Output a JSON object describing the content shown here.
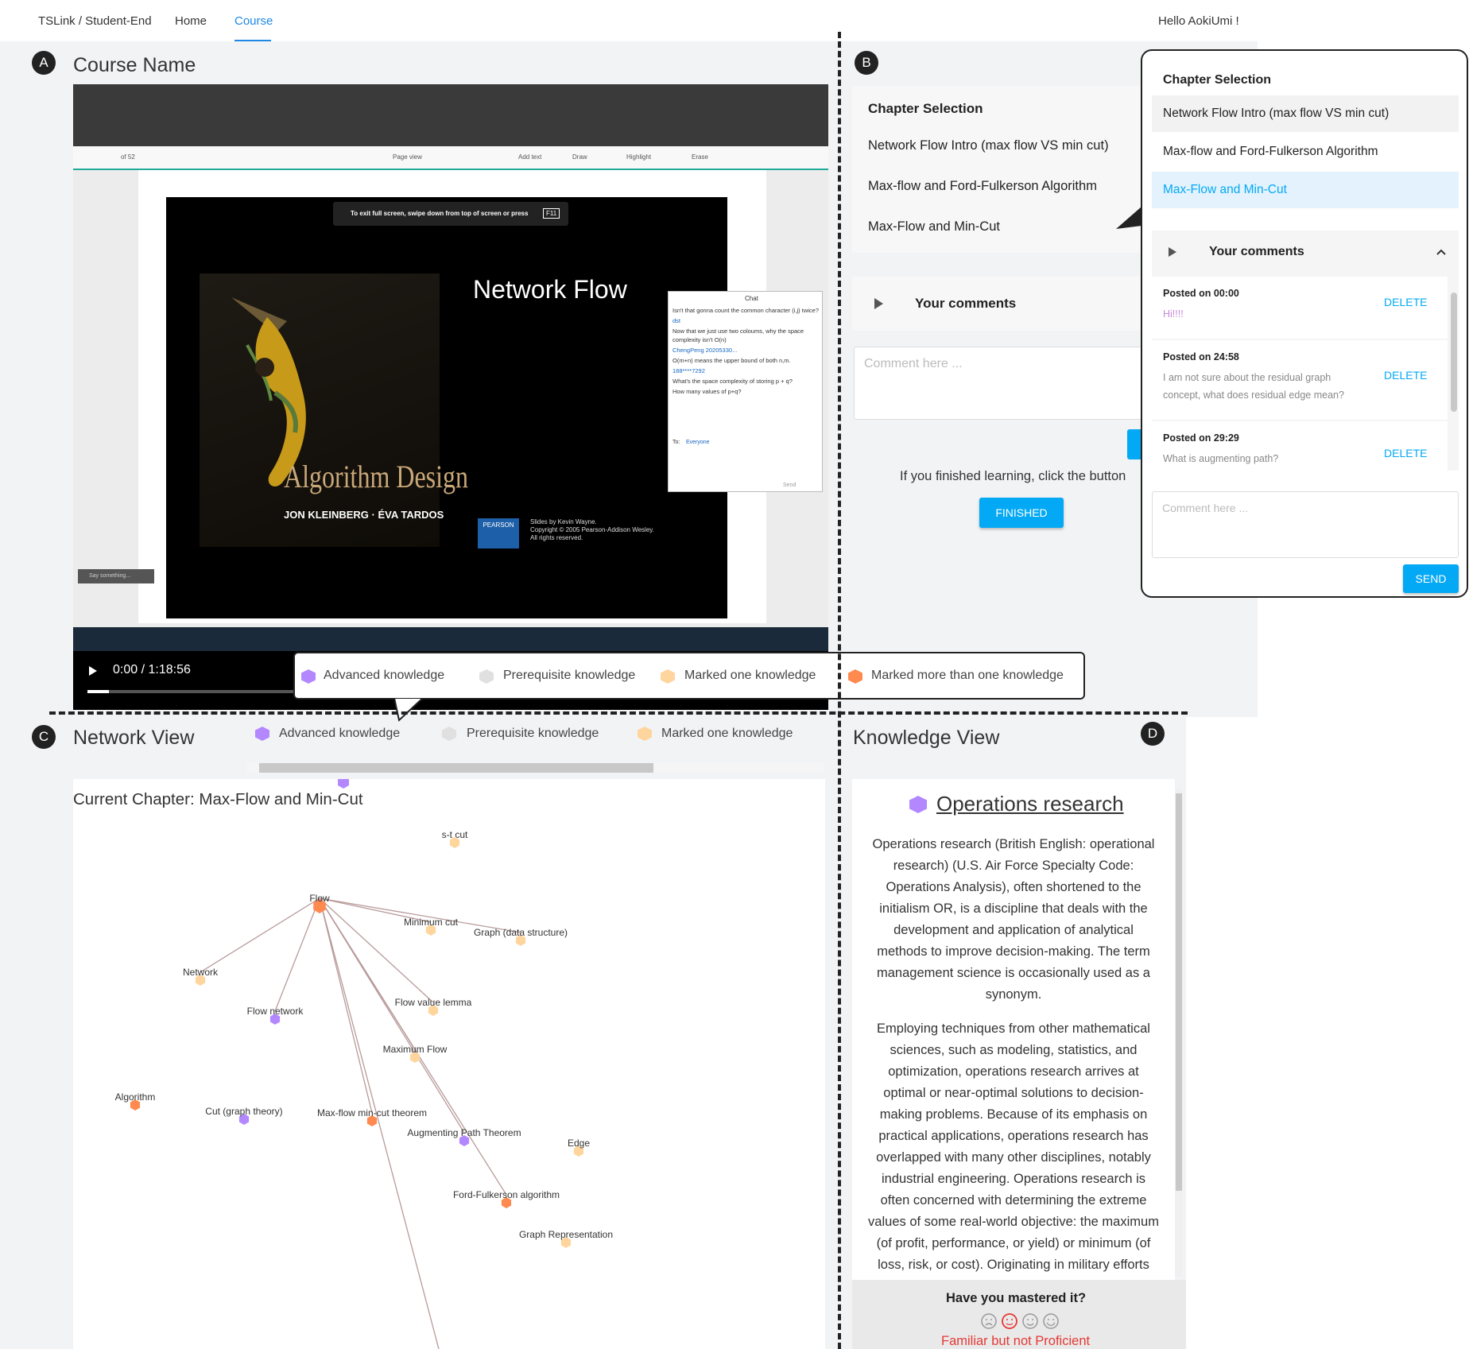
{
  "nav": {
    "brand": "TSLink / Student-End",
    "home": "Home",
    "course": "Course",
    "greeting": "Hello AokiUmi !"
  },
  "badges": {
    "a": "A",
    "b": "B",
    "c": "C",
    "d": "D"
  },
  "video": {
    "title": "Course Name",
    "time": "0:00 / 1:18:56",
    "progress": 0.03,
    "slide_exit_hint": "To exit full screen, swipe down from top of screen or press",
    "slide_key": "F11",
    "slide_title": "Network Flow",
    "book_title": "Algorithm Design",
    "book_authors": "JON KLEINBERG · ÉVA TARDOS",
    "publisher": "PEARSON",
    "credit1": "Slides by Kevin Wayne.",
    "credit2": "Copyright © 2005 Pearson-Addison Wesley.",
    "credit3": "All rights reserved.",
    "toolbar_page": "of 52",
    "toolbar_add_text": "Add text",
    "toolbar_draw": "Draw",
    "toolbar_highlight": "Highlight",
    "toolbar_erase": "Erase",
    "toolbar_pageview": "Page view",
    "chat_title": "Chat",
    "chat_to_label": "To:",
    "chat_to": "Everyone",
    "chat_send": "Send",
    "chat_lines": [
      "Isn't that gonna count the common character (i,j) twice?",
      "dst",
      "Now that we just use two coloums, why the space complexity isn't O(n)",
      "ChengPeng 20205330...",
      "O(m+n) means the upper bound of both n,m.",
      "188****7292",
      "What's the space complexity of storing p + q?",
      "How many values of p+q?"
    ],
    "say_something": "Say something..."
  },
  "legend": {
    "advanced": "Advanced knowledge",
    "prerequisite": "Prerequisite knowledge",
    "marked_one": "Marked one knowledge",
    "marked_more": "Marked more than one knowledge",
    "colors": {
      "advanced": "#b388ff",
      "prerequisite": "#e0e0e0",
      "marked_one": "#ffd59e",
      "marked_more": "#ff8a50"
    }
  },
  "chapters": {
    "heading": "Chapter Selection",
    "items": [
      "Network Flow Intro (max flow VS min cut)",
      "Max-flow and Ford-Fulkerson Algorithm",
      "Max-Flow and Min-Cut"
    ],
    "selected": 2
  },
  "comments": {
    "heading": "Your comments",
    "placeholder": "Comment here ...",
    "finish_prompt": "If you finished learning, click the button",
    "finished": "FINISHED",
    "send": "SEND",
    "delete": "DELETE",
    "items": [
      {
        "posted": "Posted on 00:00",
        "text": "Hi!!!!"
      },
      {
        "posted": "Posted on 24:58",
        "text1": "I am not sure about the residual graph",
        "text2": "concept, what does residual edge mean?"
      },
      {
        "posted": "Posted on 29:29",
        "text": "What is augmenting path?"
      }
    ]
  },
  "network": {
    "title": "Network View",
    "current_chapter": "Current Chapter: Max-Flow and Min-Cut",
    "nodes": [
      {
        "label": "Flow",
        "type": "marked_more"
      },
      {
        "label": "s-t cut",
        "type": "marked_one"
      },
      {
        "label": "Minimum cut",
        "type": "marked_one"
      },
      {
        "label": "Graph (data structure)",
        "type": "marked_one"
      },
      {
        "label": "Network",
        "type": "marked_one"
      },
      {
        "label": "Flow network",
        "type": "advanced"
      },
      {
        "label": "Flow value lemma",
        "type": "marked_one"
      },
      {
        "label": "Maximum Flow",
        "type": "marked_one"
      },
      {
        "label": "Algorithm",
        "type": "marked_more"
      },
      {
        "label": "Cut (graph theory)",
        "type": "advanced"
      },
      {
        "label": "Max-flow min-cut theorem",
        "type": "marked_more"
      },
      {
        "label": "Augmenting Path Theorem",
        "type": "advanced"
      },
      {
        "label": "Edge",
        "type": "marked_one"
      },
      {
        "label": "Ford-Fulkerson algorithm",
        "type": "marked_more"
      },
      {
        "label": "Graph Representation",
        "type": "marked_one"
      }
    ]
  },
  "knowledge": {
    "title": "Knowledge View",
    "topic": "Operations research",
    "p1": [
      "Operations research (British English: operational",
      "research) (U.S. Air Force Specialty Code:",
      "Operations Analysis), often shortened to the",
      "initialism OR, is a discipline that deals with the",
      "development and application of analytical",
      "methods to improve decision-making. The term",
      "management science is occasionally used as a",
      "synonym."
    ],
    "p2": [
      "Employing techniques from other mathematical",
      "sciences, such as modeling, statistics, and",
      "optimization, operations research arrives at",
      "optimal or near-optimal solutions to decision-",
      "making problems. Because of its emphasis on",
      "practical applications, operations research has",
      "overlapped with many other disciplines, notably",
      "industrial engineering. Operations research is",
      "often concerned with determining the extreme",
      "values of some real-world objective: the maximum",
      "(of profit, performance, or yield) or minimum (of",
      "loss, risk, or cost). Originating in military efforts"
    ],
    "mastery_question": "Have you mastered it?",
    "mastery_level": "Familiar but not Proficient"
  }
}
